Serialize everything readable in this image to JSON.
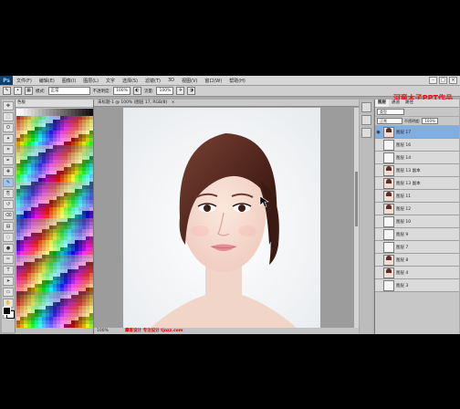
{
  "app": {
    "logo": "Ps",
    "menus": [
      "文件(F)",
      "编辑(E)",
      "图像(I)",
      "图层(L)",
      "文字",
      "选择(S)",
      "滤镜(T)",
      "3D",
      "视图(V)",
      "窗口(W)",
      "帮助(H)"
    ],
    "window_controls": [
      "–",
      "□",
      "×"
    ]
  },
  "options_bar": {
    "mode_label": "模式:",
    "mode_value": "正常",
    "opacity_label": "不透明度:",
    "opacity_value": "100%",
    "flow_label": "流量:",
    "flow_value": "100%"
  },
  "watermark": "河童木子PPT作品",
  "document": {
    "tab_title": "未标题-1 @ 100% (图层 17, RGB/8)",
    "close": "×",
    "status_zoom": "100%",
    "credit": "摩客设计 专注设计 tjnzz.com"
  },
  "layers_panel": {
    "tabs": [
      "图层",
      "通道",
      "路径"
    ],
    "kind_value": "类型",
    "blend_value": "正常",
    "opacity_label": "不透明度:",
    "opacity_value": "100%",
    "layers": [
      {
        "name": "图层 17",
        "visible": true,
        "selected": true,
        "portrait": true
      },
      {
        "name": "图层 16",
        "visible": false,
        "selected": false,
        "portrait": false
      },
      {
        "name": "图层 14",
        "visible": false,
        "selected": false,
        "portrait": false
      },
      {
        "name": "图层 13 副本",
        "visible": false,
        "selected": false,
        "portrait": true
      },
      {
        "name": "图层 13 副本",
        "visible": false,
        "selected": false,
        "portrait": true
      },
      {
        "name": "图层 11",
        "visible": false,
        "selected": false,
        "portrait": true
      },
      {
        "name": "图层 12",
        "visible": false,
        "selected": false,
        "portrait": true
      },
      {
        "name": "图层 10",
        "visible": false,
        "selected": false,
        "portrait": false
      },
      {
        "name": "图层 9",
        "visible": false,
        "selected": false,
        "portrait": false
      },
      {
        "name": "图层 7",
        "visible": false,
        "selected": false,
        "portrait": false
      },
      {
        "name": "图层 8",
        "visible": false,
        "selected": false,
        "portrait": true
      },
      {
        "name": "图层 4",
        "visible": false,
        "selected": false,
        "portrait": true
      },
      {
        "name": "图层 3",
        "visible": false,
        "selected": false,
        "portrait": false
      }
    ]
  },
  "swatches_tab": "色板",
  "tools": [
    "move",
    "marquee",
    "lasso",
    "quick-select",
    "crop",
    "eyedropper",
    "healing",
    "brush",
    "clone",
    "history-brush",
    "eraser",
    "gradient",
    "blur",
    "dodge",
    "pen",
    "type",
    "path-select",
    "shape",
    "hand",
    "zoom"
  ],
  "colors": {
    "accent": "#7faee3",
    "watermark": "#e0131b"
  }
}
